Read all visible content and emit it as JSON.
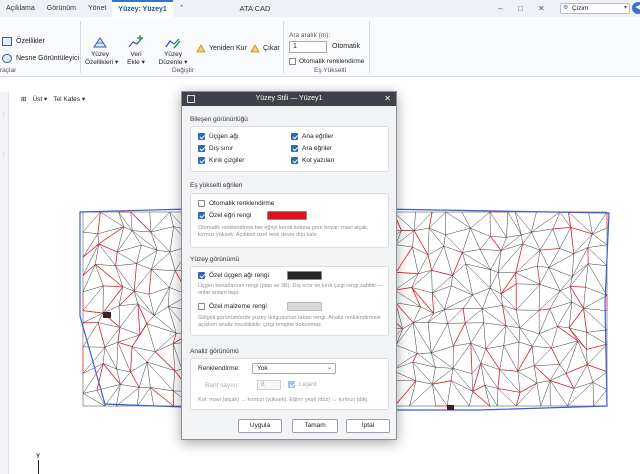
{
  "tabs": [
    "Açıklama",
    "Görünüm",
    "Yönet",
    "Yüzey: Yüzey1"
  ],
  "app_title": "ATA CAD",
  "workspace": {
    "label": "Çizim"
  },
  "ribbon": {
    "properties": "Özellikler",
    "object_viewer": "Nesne Görüntüleyici",
    "group_left_fragment": "raçlar",
    "surface_properties": "Yüzey\nÖzellikleri ▾",
    "add_data": "Veri\nEkle ▾",
    "edit_surface": "Yüzey\nDüzenle ▾",
    "rebuild": "Yeniden Kur",
    "extract": "Çıkar",
    "group_modify": "Değiştir",
    "interval_label": "Ara aralık (m):",
    "interval_value": "1",
    "contours": "Otomatik",
    "auto_render": "Otomatik renklendirme",
    "group_contour": "Eş Yükselti"
  },
  "canvas": {
    "view": "Üst",
    "style": "Tel Kafes",
    "axis_label": "Y",
    "mesh_colors": {
      "triangles": "#222222",
      "major": "#d91f26",
      "boundary": "#3a5fd0",
      "dark": "#3a2020"
    }
  },
  "dialog": {
    "title": "Yüzey Stili — Yüzey1",
    "sections": {
      "visibility": "Bileşen görünürlüğü",
      "contours": "Eş yükselti eğrileri",
      "surface": "Yüzey görünümü",
      "analysis": "Analiz görünümü"
    },
    "components": {
      "triangles": "Üçgen ağı",
      "outer": "Dış sınır",
      "breaklines": "Kırık çizgiler",
      "major": "Ana eğriler",
      "minor": "Ara eğriler",
      "spot": "Kot yazıları"
    },
    "auto_color": "Otomatik renklendirme",
    "custom_curve_color": "Özel eğri rengi",
    "curve_swatch": "#e0121a",
    "curve_note": "Otomatik renklendirme her eğriyi kendi kotuna göre boyar: mavi alçak, kırmızı yüksek. Açıkken özel renk devre dışı kalır.",
    "mesh_color": "Özel üçgen ağı rengi",
    "mesh_swatch": "#262626",
    "mesh_note": "Üçgen kenarlarının rengi (plan ve 3B). Dış sınır ve kırık çizgi rengi sabittir — onlar anlam taşır.",
    "material_color": "Özel malzeme rengi",
    "material_swatch": "#d8d8d8",
    "material_note": "Gölgeli görünümlerde yüzey dolgusunun taban rengi. Analiz renklendirmesi açıkken analiz önceliklidir; çizgi rengine dokunmaz.",
    "shading_label": "Renklendirme:",
    "shading_value": "Yok",
    "bands_label": "Bant sayısı:",
    "bands_value": "8",
    "legend": "Lejant",
    "analysis_note": "Kot: mavi (alçak) → kırmızı (yüksek). Eğim: yeşil (düz) → kırmızı (dik).",
    "buttons": {
      "apply": "Uygula",
      "ok": "Tamam",
      "cancel": "İptal"
    }
  }
}
